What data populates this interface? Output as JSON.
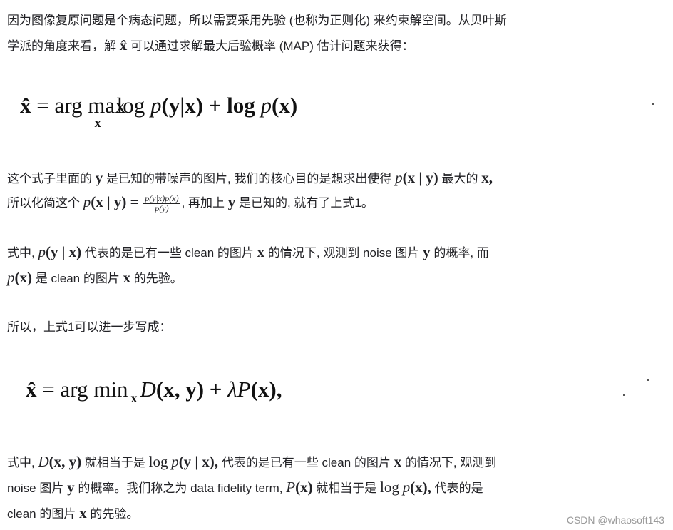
{
  "para1": {
    "line1": "因为图像复原问题是个病态问题，所以需要采用先验 (也称为正则化) 来约束解空间。从贝叶斯",
    "line2a": "学派的角度来看，解",
    "line2_sym": "x̂",
    "line2b": "可以通过求解最大后验概率 (MAP) 估计问题来获得："
  },
  "eq1": {
    "lhs": "x̂",
    "eq": "=",
    "argmax": "arg max",
    "sub": "x",
    "rest1": "log",
    "p1": "p",
    "rest2": "(y|x) + log",
    "p2": "p",
    "rest3": "(x)"
  },
  "para2": {
    "l1_a": "这个式子里面的",
    "l1_y": "y",
    "l1_b": "是已知的带噪声的图片, 我们的核心目的是想求出使得",
    "l1_p": "p",
    "l1_c": "(x | y)",
    "l1_d": "最大的",
    "l1_x": "x,",
    "l2_a": "所以化简这个",
    "l2_p": "p",
    "l2_c": "(x | y) =",
    "frac_num": "p(y|x)p(x)",
    "frac_den": "p(y)",
    "l2_d": ", 再加上",
    "l2_y": "y",
    "l2_e": "是已知的, 就有了上式1。"
  },
  "para3": {
    "l1_a": "式中,",
    "l1_p": "p",
    "l1_c": "(y | x)",
    "l1_b": "代表的是已有一些 clean 的图片",
    "l1_x": "x",
    "l1_d": "的情况下, 观测到 noise 图片",
    "l1_y": "y",
    "l1_e": "的概率, 而",
    "l2_p": "p",
    "l2_c": "(x)",
    "l2_a": "是 clean 的图片",
    "l2_x": "x",
    "l2_b": "的先验。"
  },
  "para4": {
    "text": "所以，上式1可以进一步写成："
  },
  "eq2": {
    "lhs": "x̂",
    "eq": "=",
    "argmin": "arg min",
    "sub": "x",
    "D": "D",
    "rest1": "(x, y) +",
    "lam": "λP",
    "rest2": "(x),"
  },
  "para5": {
    "l1_a": "式中,",
    "l1_D": "D",
    "l1_c": "(x, y)",
    "l1_b": "就相当于是",
    "l1_log": "log",
    "l1_p": "p",
    "l1_d": "(y | x),",
    "l1_e": "代表的是已有一些 clean 的图片",
    "l1_x": "x",
    "l1_f": "的情况下, 观测到",
    "l2_a": "noise 图片",
    "l2_y": "y",
    "l2_b": "的概率。我们称之为 data fidelity term,",
    "l2_P": "P",
    "l2_c": "(x)",
    "l2_d": "就相当于是",
    "l2_log": "log",
    "l2_p": "p",
    "l2_e": "(x),",
    "l2_f": "代表的是",
    "l3_a": "clean 的图片",
    "l3_x": "x",
    "l3_b": "的先验。"
  },
  "watermark": "CSDN @whaosoft143"
}
